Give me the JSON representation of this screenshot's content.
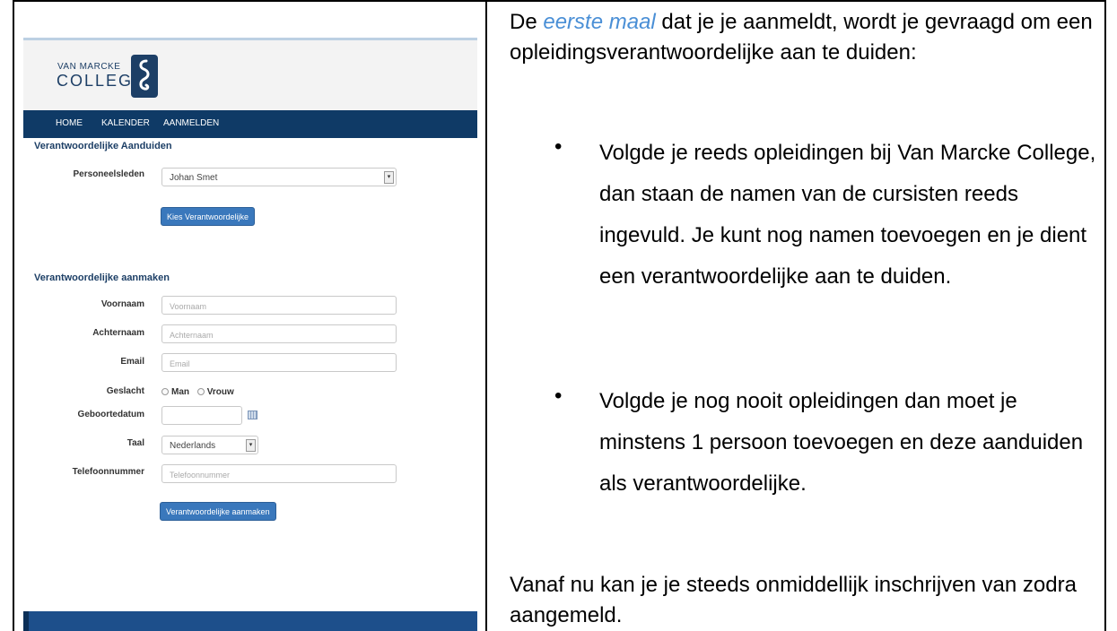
{
  "website": {
    "logo": {
      "top_text": "VAN MARCKE",
      "main_text": "COLLEGE"
    },
    "nav": [
      "HOME",
      "KALENDER",
      "AANMELDEN"
    ],
    "section1": {
      "title": "Verantwoordelijke Aanduiden",
      "personeel_label": "Personeelsleden",
      "personeel_value": "Johan Smet",
      "button": "Kies Verantwoordelijke"
    },
    "section2": {
      "title": "Verantwoordelijke aanmaken",
      "voornaam_label": "Voornaam",
      "voornaam_placeholder": "Voornaam",
      "achternaam_label": "Achternaam",
      "achternaam_placeholder": "Achternaam",
      "email_label": "Email",
      "email_placeholder": "Email",
      "geslacht_label": "Geslacht",
      "geslacht_options": [
        "Man",
        "Vrouw"
      ],
      "geboortedatum_label": "Geboortedatum",
      "taal_label": "Taal",
      "taal_value": "Nederlands",
      "telefoon_label": "Telefoonnummer",
      "telefoon_placeholder": "Telefoonnummer",
      "button": "Verantwoordelijke aanmaken"
    }
  },
  "document": {
    "intro_prefix": "De",
    "intro_emphasis": "eerste maal",
    "intro_suffix": "dat je je aanmeldt, wordt je gevraagd om een opleidingsverantwoordelijke aan te duiden:",
    "bullet_symbol": "•",
    "bullets": [
      "Volgde je reeds opleidingen bij Van Marcke College, dan staan de namen van de cursisten reeds ingevuld. Je kunt nog namen toevoegen en je dient een verantwoordelijke aan te duiden.",
      "Volgde je nog nooit opleidingen dan moet je minstens 1 persoon toevoegen en deze aanduiden als verantwoordelijke."
    ],
    "outro": "Vanaf nu kan je je steeds onmiddellijk inschrijven van zodra aangemeld."
  },
  "colors": {
    "nav_bg": "#0f3a66",
    "button_bg": "#3a78bc",
    "link_emphasis": "#4a8fd6",
    "heading": "#1d3f66"
  }
}
